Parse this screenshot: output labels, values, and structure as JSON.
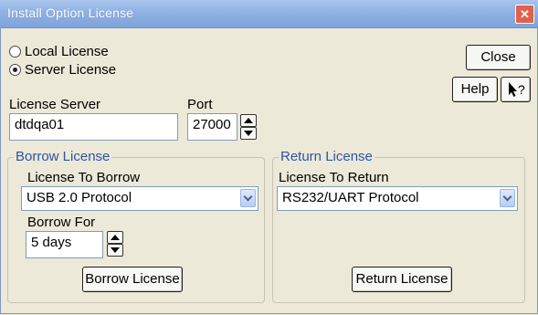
{
  "window": {
    "title": "Install Option License",
    "close_glyph": "✕"
  },
  "license_type": {
    "options": [
      {
        "label": "Local License",
        "checked": false
      },
      {
        "label": "Server License",
        "checked": true
      }
    ]
  },
  "buttons": {
    "close": "Close",
    "help": "Help",
    "whats_this_glyph": "?"
  },
  "server": {
    "label": "License Server",
    "value": "dtdqa01",
    "port_label": "Port",
    "port_value": "27000"
  },
  "borrow": {
    "group_title": "Borrow License",
    "select_label": "License To Borrow",
    "selected": "USB 2.0 Protocol",
    "duration_label": "Borrow For",
    "duration_value": "5 days",
    "button": "Borrow License"
  },
  "return": {
    "group_title": "Return License",
    "select_label": "License To Return",
    "selected": "RS232/UART Protocol",
    "button": "Return License"
  },
  "colors": {
    "titlebar": "#8fb1e3",
    "close_button": "#e2614c",
    "group_title": "#2b53a8",
    "dialog_bg": "#ece9d8"
  }
}
